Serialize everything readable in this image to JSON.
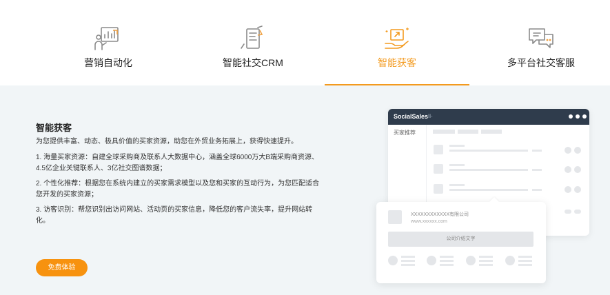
{
  "tabs": [
    {
      "label": "营销自动化",
      "icon": "marketing-automation-icon",
      "active": false
    },
    {
      "label": "智能社交CRM",
      "icon": "social-crm-icon",
      "active": false
    },
    {
      "label": "智能获客",
      "icon": "customer-acquisition-icon",
      "active": true
    },
    {
      "label": "多平台社交客服",
      "icon": "multiplatform-service-icon",
      "active": false
    }
  ],
  "panel": {
    "title": "智能获客",
    "intro": "为您提供丰富、动态、极具价值的买家资源，助您在外贸业务拓展上，获得快速提升。",
    "items": [
      "1. 海量买家资源：自建全球采购商及联系人大数据中心，涵盖全球6000万大B端采购商资源、4.5亿企业关键联系人、3亿社交图谱数据；",
      "2. 个性化推荐：根据您在系统内建立的买家需求模型以及您和买家的互动行为，为您匹配适合您开发的买家资源；",
      "3. 访客识别：帮您识别出访问网站、活动页的买家信息，降低您的客户流失率，提升网站转化。"
    ],
    "cta": "免费体验"
  },
  "mock": {
    "app_name": "SocialSales",
    "filter_icon": "filter-icon",
    "sidebar_label": "买家推荐",
    "card": {
      "company": "XXXXXXXXXXXX有限公司",
      "url": "www.xxxxxx.com",
      "button": "公司介绍文字"
    }
  },
  "colors": {
    "accent": "#f39a1e",
    "cta": "#f7920f",
    "panel_bg": "#f1f5f7",
    "mock_bar": "#2f3c4c"
  }
}
